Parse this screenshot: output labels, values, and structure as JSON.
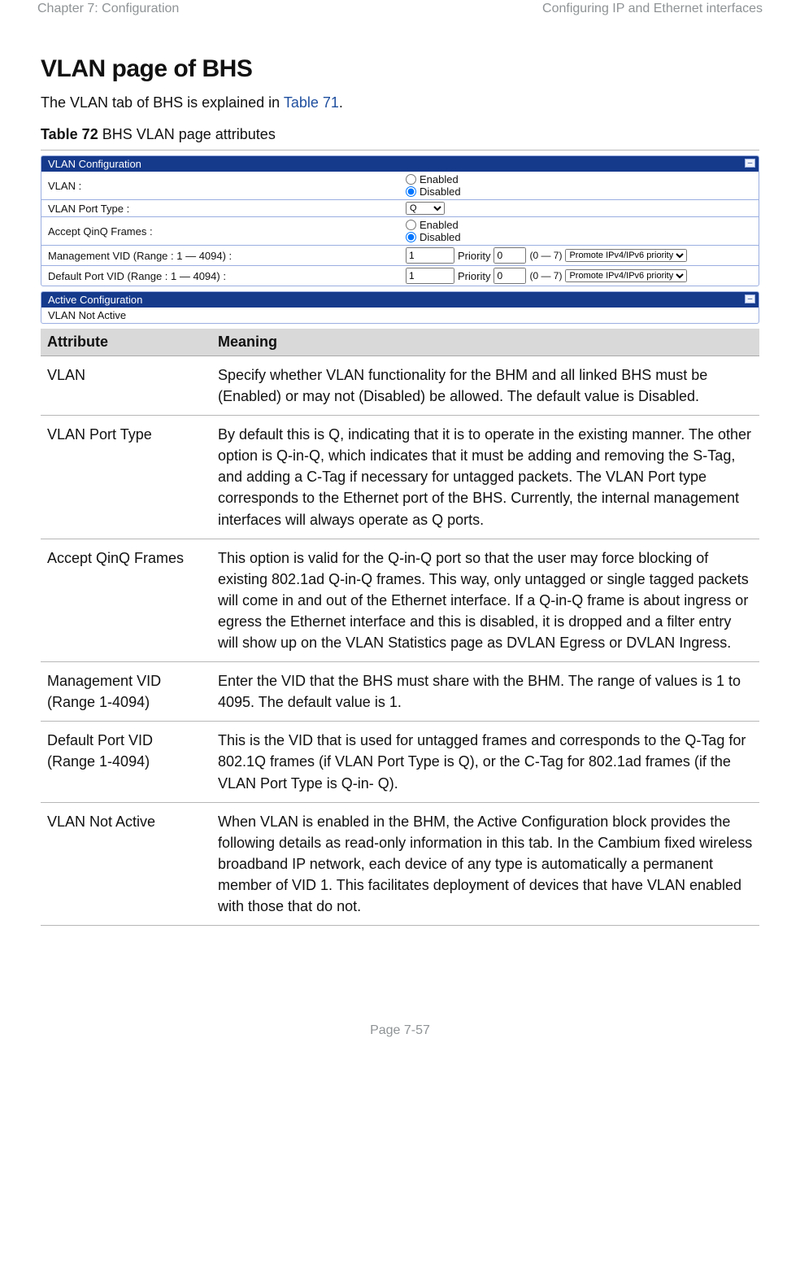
{
  "header": {
    "left": "Chapter 7:  Configuration",
    "right": "Configuring IP and Ethernet interfaces"
  },
  "section_title": "VLAN page of BHS",
  "intro_parts": {
    "before_link": "The VLAN tab of BHS is explained in ",
    "link_text": "Table 71",
    "after_link": "."
  },
  "table_caption": {
    "label": "Table 72",
    "text": "  BHS VLAN page attributes"
  },
  "vlan_config": {
    "panel_title": "VLAN Configuration",
    "rows": {
      "vlan": {
        "label": "VLAN :",
        "enabled_label": "Enabled",
        "disabled_label": "Disabled",
        "selected": "Disabled"
      },
      "port_type": {
        "label": "VLAN Port Type :",
        "select_value": "Q"
      },
      "accept_qinq": {
        "label": "Accept QinQ Frames :",
        "enabled_label": "Enabled",
        "disabled_label": "Disabled",
        "selected": "Disabled"
      },
      "mgmt_vid": {
        "label": "Management VID (Range : 1 — 4094) :",
        "value": "1",
        "priority_label": "Priority",
        "priority_value": "0",
        "range_text": "(0 — 7)",
        "select_value": "Promote IPv4/IPv6 priority"
      },
      "default_vid": {
        "label": "Default Port VID (Range : 1 — 4094) :",
        "value": "1",
        "priority_label": "Priority",
        "priority_value": "0",
        "range_text": "(0 — 7)",
        "select_value": "Promote IPv4/IPv6 priority"
      }
    }
  },
  "active_config": {
    "panel_title": "Active Configuration",
    "status": "VLAN Not Active"
  },
  "attr_table": {
    "headers": {
      "attribute": "Attribute",
      "meaning": "Meaning"
    },
    "rows": [
      {
        "attribute": "VLAN",
        "meaning": "Specify whether VLAN functionality for the BHM and all linked BHS must be (Enabled) or may not (Disabled) be allowed. The default value is Disabled."
      },
      {
        "attribute": "VLAN Port Type",
        "meaning": "By default this is Q, indicating that it is to operate in the existing manner. The other option is Q-in-Q, which indicates that it must be adding and removing the S-Tag, and adding a C-Tag if necessary for untagged packets. The VLAN Port type corresponds to the Ethernet port of the BHS. Currently, the internal management interfaces will always operate as Q ports."
      },
      {
        "attribute": "Accept QinQ Frames",
        "meaning": "This option is valid for the Q-in-Q port so that the user may force blocking of existing 802.1ad Q-in-Q frames. This way, only untagged or single tagged packets will come in and out of the Ethernet interface. If a Q-in-Q frame is about ingress or egress the Ethernet interface and this is disabled, it is dropped and a filter entry will show up on the VLAN Statistics page as DVLAN Egress or DVLAN Ingress."
      },
      {
        "attribute": "Management VID (Range 1-4094)",
        "meaning": "Enter the VID that the BHS must share with the BHM. The range of values is 1 to 4095. The default value is 1."
      },
      {
        "attribute": "Default Port VID (Range 1-4094)",
        "meaning": "This is the VID that is used for untagged frames and corresponds to the Q-Tag for 802.1Q frames (if VLAN Port Type is Q), or the C-Tag for 802.1ad frames (if the VLAN Port Type is Q-in- Q)."
      },
      {
        "attribute": "VLAN Not Active",
        "meaning": "When VLAN is enabled in the BHM, the Active Configuration block provides the following details as read-only information in this tab. In the Cambium fixed wireless broadband IP network, each device of any type is automatically a permanent member of VID 1. This facilitates deployment of devices that have VLAN enabled with those that do not."
      }
    ]
  },
  "footer": "Page 7-57"
}
